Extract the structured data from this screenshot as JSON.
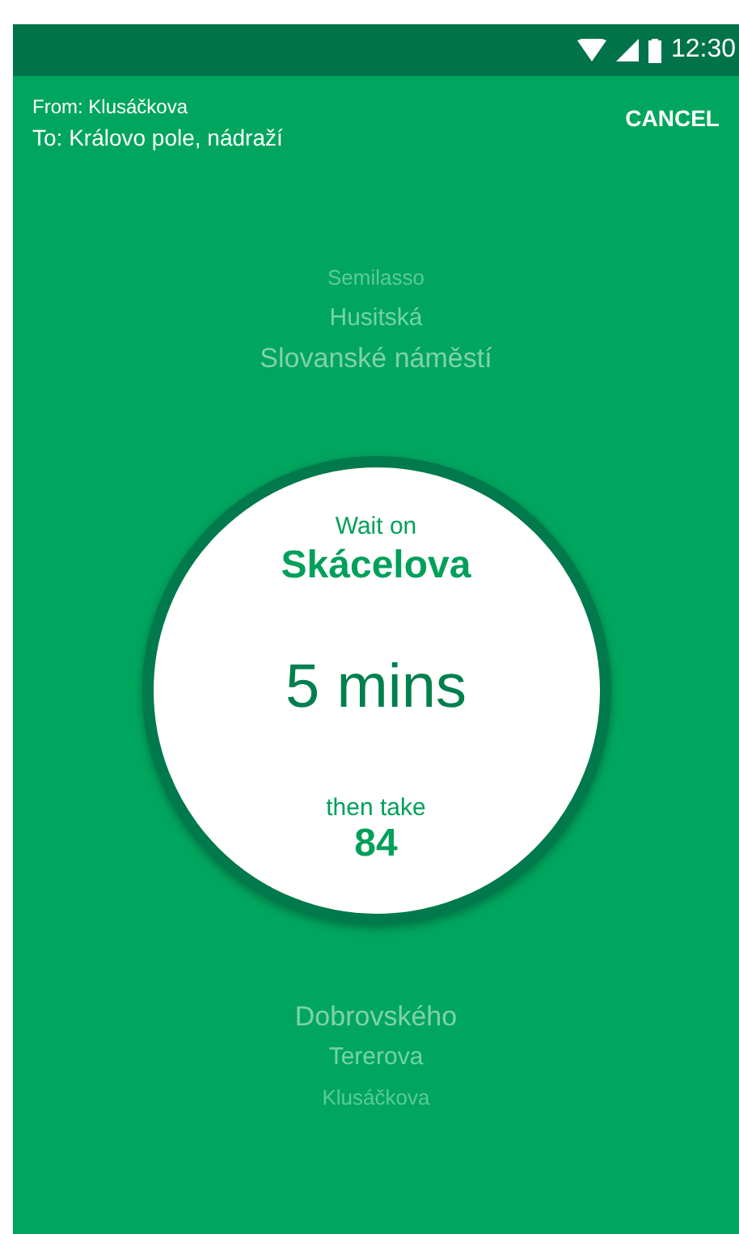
{
  "status_bar": {
    "time": "12:30"
  },
  "header": {
    "from": "From: Klusáčkova",
    "to": "To: Královo pole, nádraží",
    "action": "CANCEL"
  },
  "stops_before": [
    {
      "name": "Semilasso",
      "kind": "faint"
    },
    {
      "name": "Husitská",
      "kind": "dim"
    },
    {
      "name": "Slovanské náměstí",
      "kind": "near"
    }
  ],
  "current": {
    "label": "Wait on",
    "stop": "Skácelova",
    "wait": "5 mins",
    "then_label": "then take",
    "line": "84"
  },
  "stops_after": [
    {
      "name": "Dobrovského",
      "kind": "near"
    },
    {
      "name": "Tererova",
      "kind": "dim"
    },
    {
      "name": "Klusáčkova",
      "kind": "faint"
    }
  ]
}
